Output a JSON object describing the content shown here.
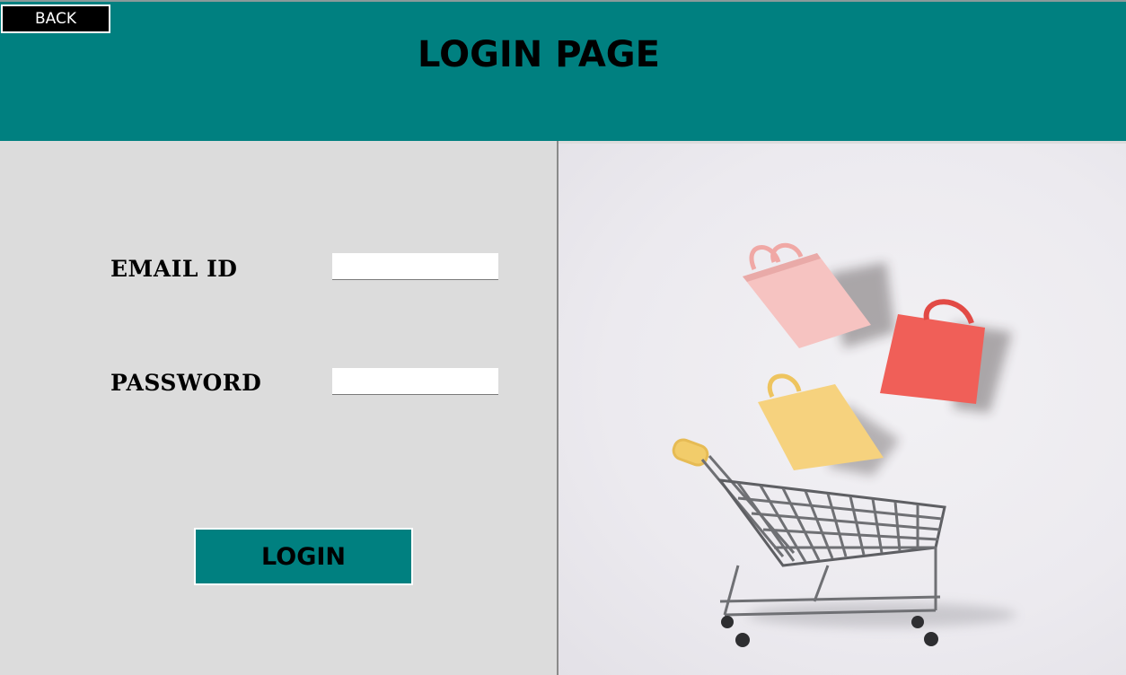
{
  "header": {
    "back_label": "BACK",
    "title": "LOGIN PAGE"
  },
  "form": {
    "email_label": "EMAIL ID",
    "email_value": "",
    "password_label": "PASSWORD",
    "password_value": "",
    "login_label": "LOGIN"
  },
  "colors": {
    "accent": "#008080",
    "panel": "#dcdcdc",
    "back_button": "#000000"
  },
  "image": {
    "icon": "shopping-cart-with-bags-photo"
  }
}
